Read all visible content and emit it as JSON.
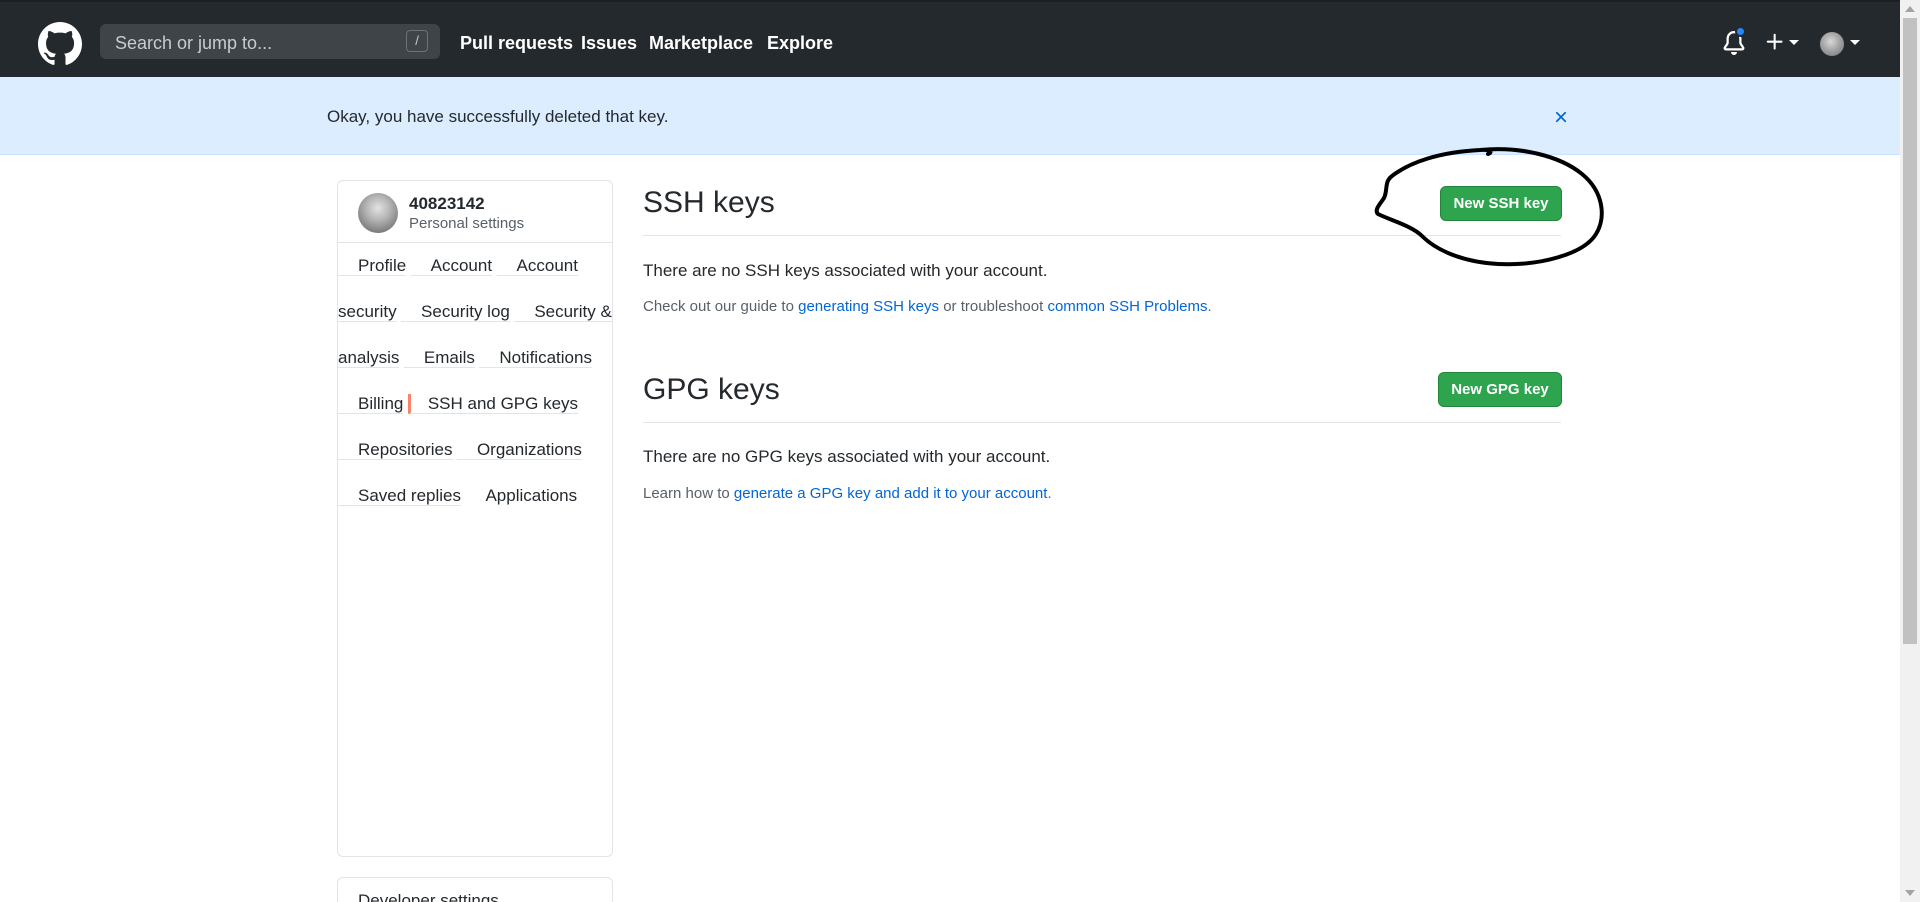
{
  "header": {
    "search_placeholder": "Search or jump to...",
    "search_shortcut": "/",
    "nav": [
      "Pull requests",
      "Issues",
      "Marketplace",
      "Explore"
    ]
  },
  "flash": {
    "message": "Okay, you have successfully deleted that key."
  },
  "sidebar": {
    "username": "40823142",
    "subtitle": "Personal settings",
    "items": [
      "Profile",
      "Account",
      "Account security",
      "Security log",
      "Security & analysis",
      "Emails",
      "Notifications",
      "Billing",
      "SSH and GPG keys",
      "Repositories",
      "Organizations",
      "Saved replies",
      "Applications"
    ],
    "selected": "SSH and GPG keys",
    "developer_settings": "Developer settings"
  },
  "ssh": {
    "title": "SSH keys",
    "button": "New SSH key",
    "empty": "There are no SSH keys associated with your account.",
    "note_prefix": "Check out our guide to ",
    "note_link1": "generating SSH keys",
    "note_middle": " or troubleshoot ",
    "note_link2": "common SSH Problems",
    "note_suffix": "."
  },
  "gpg": {
    "title": "GPG keys",
    "button": "New GPG key",
    "empty": "There are no GPG keys associated with your account.",
    "note_prefix": "Learn how to ",
    "note_link": "generate a GPG key and add it to your account",
    "note_suffix": "."
  },
  "colors": {
    "header_bg": "#24292e",
    "flash_bg": "#dbedff",
    "button_green": "#2ea44f",
    "link_blue": "#0366d6",
    "selected_accent": "#f9826c",
    "notification_dot": "#2188ff"
  },
  "icons": [
    "github-logo-icon",
    "bell-icon",
    "plus-icon",
    "caret-down-icon",
    "close-icon"
  ]
}
